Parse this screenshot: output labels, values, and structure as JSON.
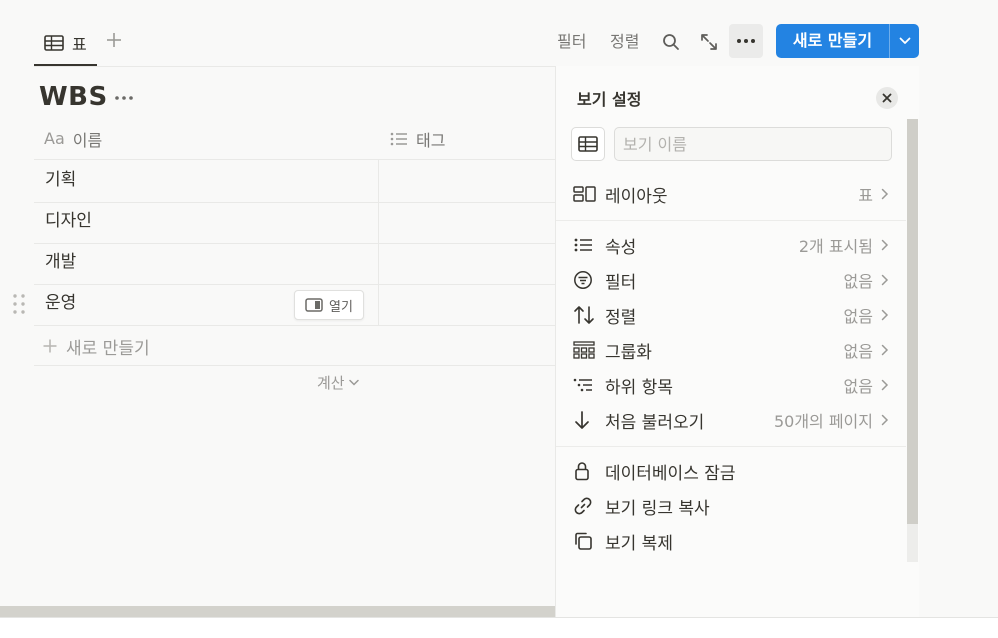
{
  "toolbar": {
    "tab_label": "표",
    "filter_label": "필터",
    "sort_label": "정렬",
    "new_button_label": "새로 만들기"
  },
  "table": {
    "title": "WBS",
    "columns": [
      {
        "icon": "aa-text-icon",
        "label": "이름"
      },
      {
        "icon": "list-icon",
        "label": "태그"
      }
    ],
    "name_prefix": "Aa",
    "rows": [
      "기획",
      "디자인",
      "개발",
      "운영"
    ],
    "open_label": "열기",
    "new_row_label": "새로 만들기",
    "calc_label": "계산"
  },
  "panel": {
    "title": "보기 설정",
    "view_name_placeholder": "보기 이름",
    "items": [
      {
        "icon": "layout-icon",
        "label": "레이아웃",
        "value": "표"
      },
      {
        "icon": "list-icon",
        "label": "속성",
        "value": "2개 표시됨"
      },
      {
        "icon": "filter-icon",
        "label": "필터",
        "value": "없음"
      },
      {
        "icon": "sort-icon",
        "label": "정렬",
        "value": "없음"
      },
      {
        "icon": "group-icon",
        "label": "그룹화",
        "value": "없음"
      },
      {
        "icon": "subitems-icon",
        "label": "하위 항목",
        "value": "없음"
      },
      {
        "icon": "arrow-down-icon",
        "label": "처음 불러오기",
        "value": "50개의 페이지"
      },
      {
        "icon": "lock-icon",
        "label": "데이터베이스 잠금",
        "value": ""
      },
      {
        "icon": "link-icon",
        "label": "보기 링크 복사",
        "value": ""
      },
      {
        "icon": "duplicate-icon",
        "label": "보기 복제",
        "value": ""
      }
    ]
  },
  "colors": {
    "accent": "#2383e2",
    "text": "#37352f",
    "muted": "#9b9a97",
    "background": "#f9f9f8"
  }
}
